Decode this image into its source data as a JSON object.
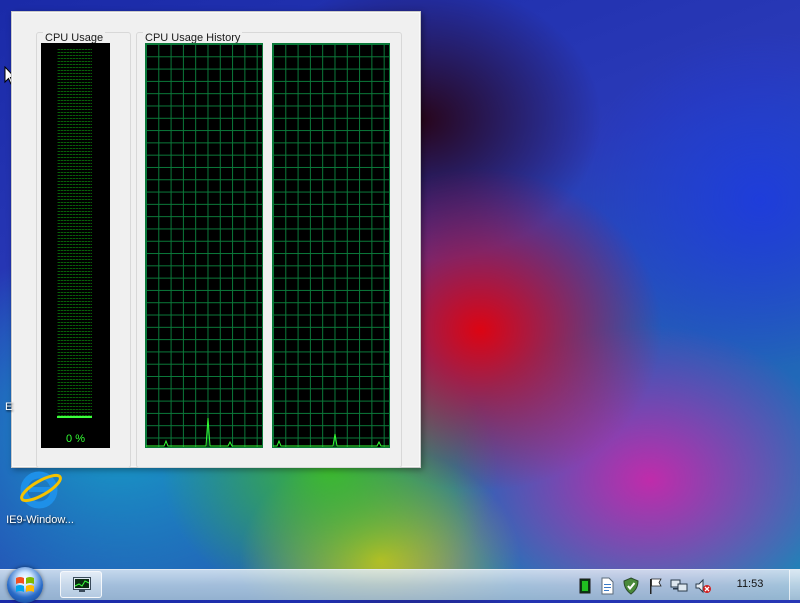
{
  "gadget": {
    "usage_title": "CPU Usage",
    "history_title": "CPU Usage History",
    "usage_value": "0 %",
    "usage_percent": 0
  },
  "desktop": {
    "icons": [
      {
        "label": "IE9-Window...",
        "icon": "internet-explorer-icon"
      }
    ],
    "partial_label": "E"
  },
  "taskbar": {
    "start": "windows-start-icon",
    "open_app": "task-manager-icon",
    "tray_icons": [
      "cpu-meter-icon",
      "document-icon",
      "security-shield-icon",
      "action-center-flag-icon",
      "network-icon",
      "volume-muted-icon"
    ],
    "clock": "11:53"
  },
  "colors": {
    "graph_line": "#33ff33",
    "grid": "#0b7a3a"
  }
}
